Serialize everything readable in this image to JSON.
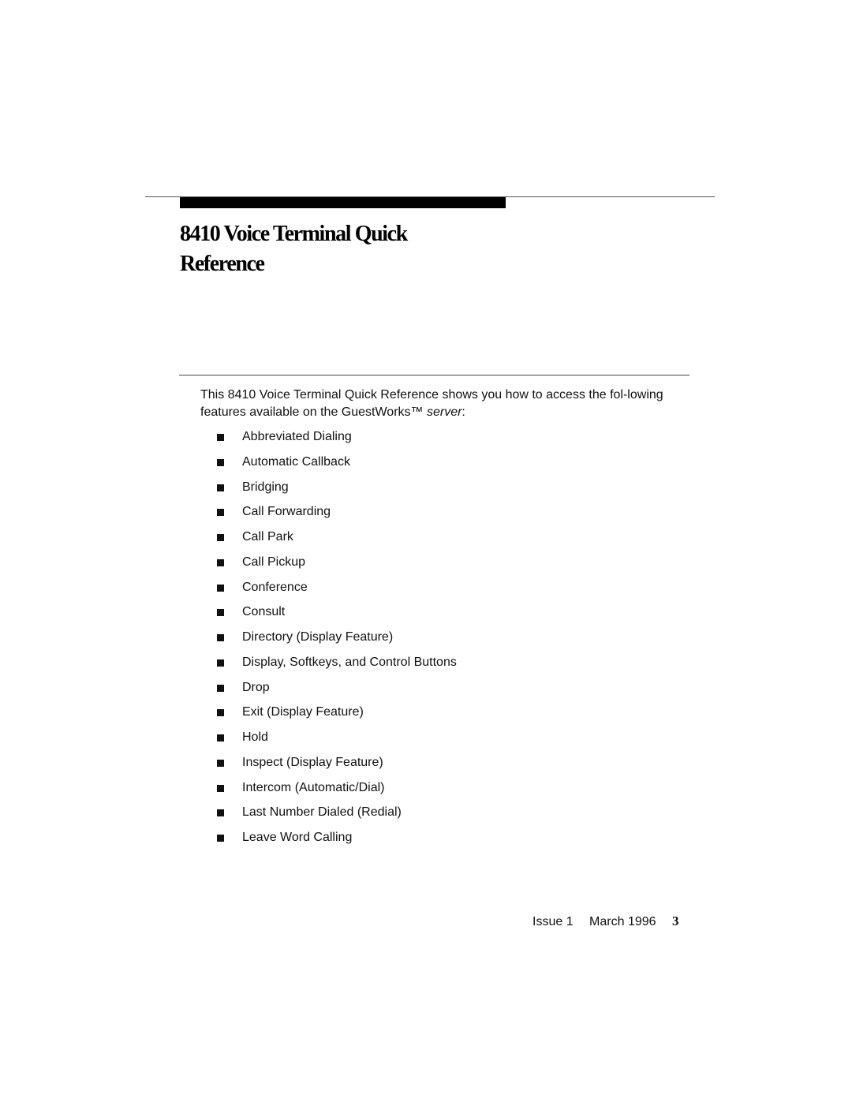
{
  "chapter": {
    "title_line1": "8410 Voice Terminal Quick",
    "title_line2": "Reference"
  },
  "intro": {
    "text_before": "This 8410 Voice Terminal Quick Reference shows you how to access the fol-lowing features available on the GuestWorks™ ",
    "text_italic": "server",
    "text_after": ":"
  },
  "features": [
    "Abbreviated Dialing",
    "Automatic Callback",
    "Bridging",
    "Call Forwarding",
    "Call Park",
    "Call Pickup",
    "Conference",
    "Consult",
    "Directory (Display Feature)",
    "Display, Softkeys, and Control Buttons",
    "Drop",
    "Exit (Display Feature)",
    "Hold",
    "Inspect (Display Feature)",
    "Intercom (Automatic/Dial)",
    "Last Number Dialed (Redial)",
    "Leave Word Calling"
  ],
  "footer": {
    "issue": "Issue 1",
    "date": "March 1996",
    "page_number": "3"
  }
}
